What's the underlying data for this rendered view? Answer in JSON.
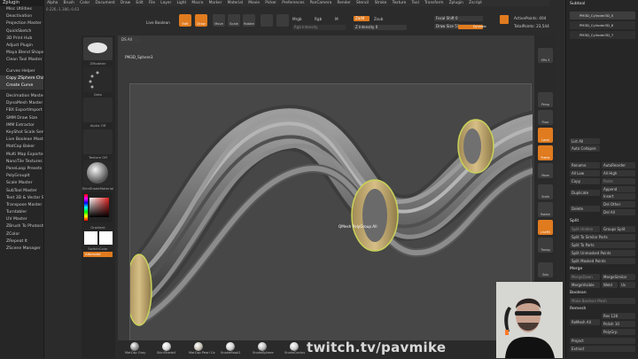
{
  "left_panel": {
    "title": "Zplugin",
    "items": [
      {
        "label": "Misc Utilities",
        "gap": false,
        "sel": false
      },
      {
        "label": "Deactivation",
        "gap": false,
        "sel": false
      },
      {
        "label": "Projection Master",
        "gap": false,
        "sel": false
      },
      {
        "label": "QuickSketch",
        "gap": false,
        "sel": false
      },
      {
        "label": "3D Print Hub",
        "gap": false,
        "sel": false
      },
      {
        "label": "Adjust Plugin",
        "gap": false,
        "sel": false
      },
      {
        "label": "Maya Blend Shapes",
        "gap": false,
        "sel": false
      },
      {
        "label": "Clean Tool Master",
        "gap": false,
        "sel": false
      },
      {
        "label": "Curves Helper",
        "gap": true,
        "sel": false
      },
      {
        "label": "Copy ZSphere Chain",
        "gap": false,
        "sel": true
      },
      {
        "label": "Create Curve",
        "gap": false,
        "sel": true
      },
      {
        "label": "Decimation Master",
        "gap": true,
        "sel": false
      },
      {
        "label": "DynaMesh Master",
        "gap": false,
        "sel": false
      },
      {
        "label": "FBX ExportImport",
        "gap": false,
        "sel": false
      },
      {
        "label": "SMM Draw Size",
        "gap": false,
        "sel": false
      },
      {
        "label": "IMM Extractor",
        "gap": false,
        "sel": false
      },
      {
        "label": "KeyShot Scale Sender",
        "gap": false,
        "sel": false
      },
      {
        "label": "Live Boolean Master",
        "gap": false,
        "sel": false
      },
      {
        "label": "MatCap Baker",
        "gap": false,
        "sel": false
      },
      {
        "label": "Multi Map Exporter",
        "gap": false,
        "sel": false
      },
      {
        "label": "NanoTile Textures",
        "gap": false,
        "sel": false
      },
      {
        "label": "PaneLoop Presets",
        "gap": false,
        "sel": false
      },
      {
        "label": "PolyGroupIt",
        "gap": false,
        "sel": false
      },
      {
        "label": "Scale Master",
        "gap": false,
        "sel": false
      },
      {
        "label": "SubTool Master",
        "gap": false,
        "sel": false
      },
      {
        "label": "Text 3D & Vector Shapes",
        "gap": false,
        "sel": false
      },
      {
        "label": "Transpose Master",
        "gap": false,
        "sel": false
      },
      {
        "label": "Turntabler",
        "gap": false,
        "sel": false
      },
      {
        "label": "UV Master",
        "gap": false,
        "sel": false
      },
      {
        "label": "ZBrush To Photoshop",
        "gap": false,
        "sel": false
      },
      {
        "label": "ZColor",
        "gap": false,
        "sel": false
      },
      {
        "label": "ZRepeat It",
        "gap": false,
        "sel": false
      },
      {
        "label": "ZScene Manager",
        "gap": false,
        "sel": false
      }
    ]
  },
  "menubar": [
    "Alpha",
    "Brush",
    "Color",
    "Document",
    "Draw",
    "Edit",
    "File",
    "Layer",
    "Light",
    "Macro",
    "Marker",
    "Material",
    "Movie",
    "Picker",
    "Preferences",
    "PanCamera",
    "Render",
    "Stencil",
    "Stroke",
    "Texture",
    "Tool",
    "Transform",
    "Zplugin",
    "Zscript"
  ],
  "coords": "0.226,-1.386,-0.63",
  "toolbar": {
    "live_boolean": "Live Boolean",
    "ds_all": "DS All",
    "edit": "Edit",
    "draw": "Draw",
    "move": "Move",
    "scale": "Scale",
    "rotate": "Rotate",
    "mrgb": "Mrgb",
    "rgb": "Rgb",
    "m": "M",
    "zadd": "Zadd",
    "zsub": "Zsub",
    "rgb_intensity": "Rgb Intensity",
    "z_intensity": "Z Intensity 0",
    "focal_shift": "Focal Shift 0",
    "draw_size": "Draw Size 51",
    "dynamic": "Dynamic",
    "active_points": "ActivePoints: 404",
    "total_points": "TotalPoints: 23,544"
  },
  "brushcol": {
    "brush": "ZModeler",
    "stroke": "Dots",
    "alpha": "Alpha Off",
    "texture": "Texture Off",
    "material": "SkinShadeMaterial",
    "gradient": "Gradient",
    "switchcolor": "SwitchColor",
    "alternate": "Alternate",
    "tool_name": "PM3D_Sphere3"
  },
  "viewport": {
    "hud_text": "QMesh PolyGroup All"
  },
  "righticons": [
    "SPix 3",
    "Persp",
    "Floor",
    "Local",
    "Frame",
    "Move",
    "Scale",
    "Rotate",
    "LineFill",
    "Transp",
    "Solo"
  ],
  "right_panel": {
    "subtool_header": "Subtool",
    "subtools": [
      {
        "label": "PM3D_Cylinder3D_5",
        "sel": true
      },
      {
        "label": "PM3D_Cylinder3D_6",
        "sel": false
      },
      {
        "label": "PM3D_Cylinder3D_7",
        "sel": false
      }
    ],
    "list_all": "List All",
    "auto_collapse": "Auto Collapse",
    "rename": "Rename",
    "auto_reorder": "AutoReorder",
    "all_low": "All Low",
    "all_high": "All High",
    "copy": "Copy",
    "paste": "Paste",
    "append": "Append",
    "duplicate": "Duplicate",
    "insert": "Insert",
    "del_other": "Del Other",
    "delete": "Delete",
    "del_all": "Del All",
    "split_head": "Split",
    "split_hidden": "Split Hidden",
    "groups_split": "Groups Split",
    "split_to_similar": "Split To Similar Parts",
    "split_to_parts": "Split To Parts",
    "split_unmasked": "Split Unmasked Points",
    "split_masked": "Split Masked Points",
    "merge_head": "Merge",
    "merge_down": "MergeDown",
    "merge_similar": "MergeSimilar",
    "merge_visible": "MergeVisible",
    "weld": "Weld",
    "uv": "Uv",
    "boolean_head": "Boolean",
    "make_boolean": "Make Boolean Mesh",
    "remesh_head": "Remesh",
    "remesh_all": "ReMesh All",
    "res": "Res 128",
    "polish": "Polish 10",
    "polygrp": "PolyGrp",
    "project": "Project",
    "extract": "Extract"
  },
  "matcaps": [
    {
      "label": "MatCap Gray",
      "color": "#9a9a9a"
    },
    {
      "label": "SkinShade4",
      "color": "#d8d8d8"
    },
    {
      "label": "MatCap Pearl Ca",
      "color": "#c9c3b8"
    },
    {
      "label": "SnakeHook2",
      "color": "#cfcfcf"
    },
    {
      "label": "SnakeSphere",
      "color": "#bdbdbd"
    },
    {
      "label": "SnakeCactus",
      "color": "#d0d0d0"
    }
  ],
  "watermark": "twitch.tv/pavmike",
  "colors": {
    "accent": "#e07b1f",
    "panel": "#262626",
    "viewport": "#474747"
  }
}
